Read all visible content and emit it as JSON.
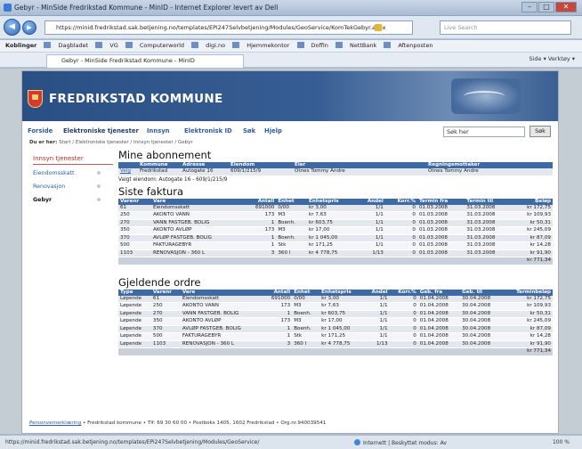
{
  "window": {
    "title": "Gebyr - MinSide Fredrikstad Kommune - MinID - Internet Explorer levert av Dell"
  },
  "address": {
    "url": "https://minid.fredrikstad.sak.betjening.no/templates/EPi247Selvbetjening/Modules/GeoService/KomTekGebyr.aspx",
    "search_placeholder": "Live Search"
  },
  "favorites": [
    "Koblinger",
    "Dagbladet",
    "VG",
    "Computerworld",
    "digi.no",
    "Hjemmekontor",
    "Doffin",
    "NettBank",
    "Aftenposten"
  ],
  "tab": {
    "label": "Gebyr - MinSide Fredrikstad Kommune - MinID",
    "tools": "Side ▾  Verktøy ▾"
  },
  "site": {
    "name": "FREDRIKSTAD KOMMUNE",
    "menu": [
      "Forside",
      "Elektroniske tjenester",
      "Innsyn",
      "Elektronisk ID",
      "Søk",
      "Hjelp"
    ],
    "search_value": "Søk her",
    "search_button": "Søk",
    "breadcrumb_prefix": "Du er her:",
    "breadcrumb": "Start / Elektroniske tjenester / Innsyn tjenester / Gebyr"
  },
  "sidebar": {
    "heading": "Innsyn tjenester",
    "items": [
      "Eiendomsskatt",
      "Renovasjon",
      "Gebyr"
    ]
  },
  "abonnement": {
    "title": "Mine abonnement",
    "headers": [
      "",
      "Kommune",
      "Adresse",
      "Eiendom",
      "Eier",
      "Regningsmottaker"
    ],
    "row": [
      "Velg",
      "Fredrikstad",
      "Autogate 16",
      "609/1/215/9",
      "Otnes Tommy Andre",
      "Otnes Tommy Andre"
    ],
    "selected": "Valgt eiendom: Autogate 16 - 609/1/215/9"
  },
  "faktura": {
    "title": "Siste faktura",
    "headers": [
      "Varenr",
      "Vare",
      "Antall",
      "Enhet",
      "Enhetspris",
      "Andel",
      "Korr.%",
      "Termin fra",
      "Termin til",
      "Beløp"
    ],
    "rows": [
      [
        "61",
        "Eiendomsskatt",
        "691000",
        "0/00",
        "kr 3,00",
        "1/1",
        "0",
        "01.03.2008",
        "31.03.2008",
        "kr 172,75"
      ],
      [
        "250",
        "AKONTO VANN",
        "173",
        "M3",
        "kr 7,63",
        "1/1",
        "0",
        "01.03.2008",
        "31.03.2008",
        "kr 109,93"
      ],
      [
        "270",
        "VANN FASTGEB. BOLIG",
        "1",
        "Boenh.",
        "kr 603,75",
        "1/1",
        "0",
        "01.03.2008",
        "31.03.2008",
        "kr 50,31"
      ],
      [
        "350",
        "AKONTO AVLØP",
        "173",
        "M3",
        "kr 17,00",
        "1/1",
        "0",
        "01.03.2008",
        "31.03.2008",
        "kr 245,09"
      ],
      [
        "370",
        "AVLØP FASTGEB. BOLIG",
        "1",
        "Boenh.",
        "kr 1 045,00",
        "1/1",
        "0",
        "01.03.2008",
        "31.03.2008",
        "kr 87,09"
      ],
      [
        "500",
        "FAKTURAGEBYR",
        "1",
        "Stk",
        "kr 171,25",
        "1/1",
        "0",
        "01.03.2008",
        "31.03.2008",
        "kr 14,28"
      ],
      [
        "1103",
        "RENOVASJON - 360 L",
        "3",
        "360 l",
        "kr 4 778,75",
        "1/13",
        "0",
        "01.03.2008",
        "31.03.2008",
        "kr 91,90"
      ]
    ],
    "total": "kr 771,34"
  },
  "ordre": {
    "title": "Gjeldende ordre",
    "headers": [
      "Type",
      "Varenr",
      "Vare",
      "Antall",
      "Enhet",
      "Enhetspris",
      "Andel",
      "Korr.%",
      "Geb. fra",
      "Geb. til",
      "Terminbeløp"
    ],
    "rows": [
      [
        "Løpende",
        "61",
        "Eiendomsskatt",
        "691000",
        "0/00",
        "kr 3,00",
        "1/1",
        "0",
        "01.04.2008",
        "30.04.2008",
        "kr 172,75"
      ],
      [
        "Løpende",
        "250",
        "AKONTO VANN",
        "173",
        "M3",
        "kr 7,63",
        "1/1",
        "0",
        "01.04.2008",
        "30.04.2008",
        "kr 109,93"
      ],
      [
        "Løpende",
        "270",
        "VANN FASTGEB. BOLIG",
        "1",
        "Boenh.",
        "kr 603,75",
        "1/1",
        "0",
        "01.04.2008",
        "30.04.2008",
        "kr 50,31"
      ],
      [
        "Løpende",
        "350",
        "AKONTO AVLØP",
        "173",
        "M3",
        "kr 17,00",
        "1/1",
        "0",
        "01.04.2008",
        "30.04.2008",
        "kr 245,09"
      ],
      [
        "Løpende",
        "370",
        "AVLØP FASTGEB. BOLIG",
        "1",
        "Boenh.",
        "kr 1 045,00",
        "1/1",
        "0",
        "01.04.2008",
        "30.04.2008",
        "kr 87,09"
      ],
      [
        "Løpende",
        "500",
        "FAKTURAGEBYR",
        "1",
        "Stk",
        "kr 171,25",
        "1/1",
        "0",
        "01.04.2008",
        "30.04.2008",
        "kr 14,28"
      ],
      [
        "Løpende",
        "1103",
        "RENOVASJON - 360 L",
        "3",
        "360 l",
        "kr 4 778,75",
        "1/13",
        "0",
        "01.04.2008",
        "30.04.2008",
        "kr 91,90"
      ]
    ],
    "total": "kr 771,34"
  },
  "footer": {
    "link": "Personvernerklæring",
    "text": " • Fredrikstad kommune • Tlf: 69 30 60 00 • Postboks 1405, 1602 Fredrikstad • Org.nr.940039541"
  },
  "status": {
    "url": "https://minid.fredrikstad.sak.betjening.no/templates/EPi247Selvbetjening/Modules/GeoService/",
    "zone": "Internett | Beskyttet modus: Av",
    "zoom": "100 %"
  }
}
